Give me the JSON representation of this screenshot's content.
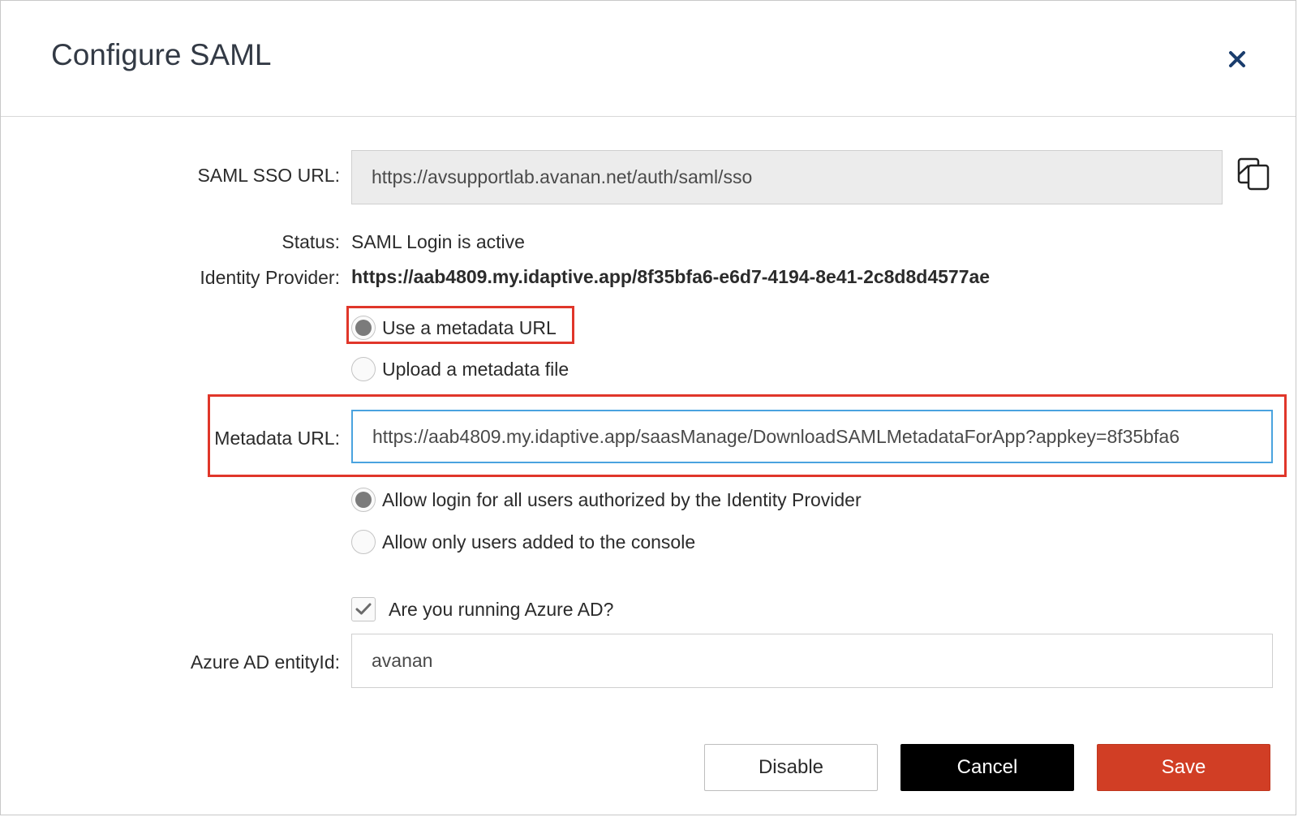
{
  "dialog": {
    "title": "Configure SAML",
    "close_icon": "close-icon"
  },
  "form": {
    "sso_url_label": "SAML SSO URL:",
    "sso_url_value": "https://avsupportlab.avanan.net/auth/saml/sso",
    "copy_icon": "copy-icon",
    "status_label": "Status:",
    "status_value": "SAML Login is active",
    "idp_label": "Identity Provider:",
    "idp_value": "https://aab4809.my.idaptive.app/8f35bfa6-e6d7-4194-8e41-2c8d8d4577ae",
    "metadata_source": {
      "options": [
        {
          "label": "Use a metadata URL",
          "selected": true
        },
        {
          "label": "Upload a metadata file",
          "selected": false
        }
      ]
    },
    "metadata_url_label": "Metadata URL:",
    "metadata_url_value": "https://aab4809.my.idaptive.app/saasManage/DownloadSAMLMetadataForApp?appkey=8f35bfa6",
    "login_policy": {
      "options": [
        {
          "label": "Allow login for all users authorized by the Identity Provider",
          "selected": true
        },
        {
          "label": "Allow only users added to the console",
          "selected": false
        }
      ]
    },
    "azure_checkbox_label": "Are you running Azure AD?",
    "azure_checked": true,
    "azure_entity_label": "Azure AD entityId:",
    "azure_entity_value": "avanan"
  },
  "buttons": {
    "disable": "Disable",
    "cancel": "Cancel",
    "save": "Save"
  },
  "colors": {
    "highlight": "#e0362a",
    "save": "#d13e25",
    "cancel": "#000000",
    "focus_border": "#4aa3df"
  }
}
